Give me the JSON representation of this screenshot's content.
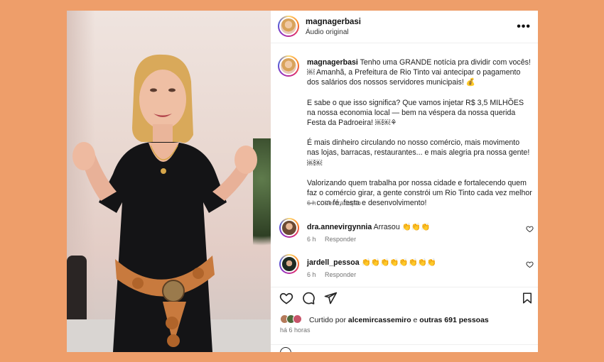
{
  "post": {
    "username": "magnagerbasi",
    "audio_label": "Áudio original",
    "caption_user": "magnagerbasi",
    "caption_p1": "Tenho uma GRANDE notícia pra dividir com vocês! ￼ Amanhã, a Prefeitura de Rio Tinto vai antecipar o pagamento dos salários dos nossos servidores municipais! 💰",
    "caption_p2": "E sabe o que isso significa? Que vamos injetar R$ 3,5 MILHÕES na nossa economia local — bem na véspera da nossa querida Festa da Padroeira! ￼￼⚘",
    "caption_p3": "É mais dinheiro circulando no nosso comércio, mais movimento nas lojas, barracas, restaurantes... e mais alegria pra nossa gente! ￼￼",
    "caption_p4": "Valorizando quem trabalha por nossa cidade e fortalecendo quem faz o comércio girar, a gente constrói um Rio Tinto cada vez melhor — com fé, festa e desenvolvimento!",
    "caption_time": "6 h",
    "translate": "Ver tradução"
  },
  "comments": [
    {
      "user": "dra.annevirgynnia",
      "text": "Arrasou 👏👏👏",
      "time": "6 h",
      "reply": "Responder"
    },
    {
      "user": "jardell_pessoa",
      "text": "👏👏👏👏👏👏👏👏",
      "time": "6 h",
      "reply": "Responder"
    }
  ],
  "likes": {
    "prefix": "Curtido por",
    "user": "alcemircassemiro",
    "middle": "e",
    "others": "outras 691 pessoas"
  },
  "timestamp": "há 6 horas",
  "icons": [
    "more-icon",
    "heart-icon",
    "comment-icon",
    "share-icon",
    "save-icon"
  ]
}
